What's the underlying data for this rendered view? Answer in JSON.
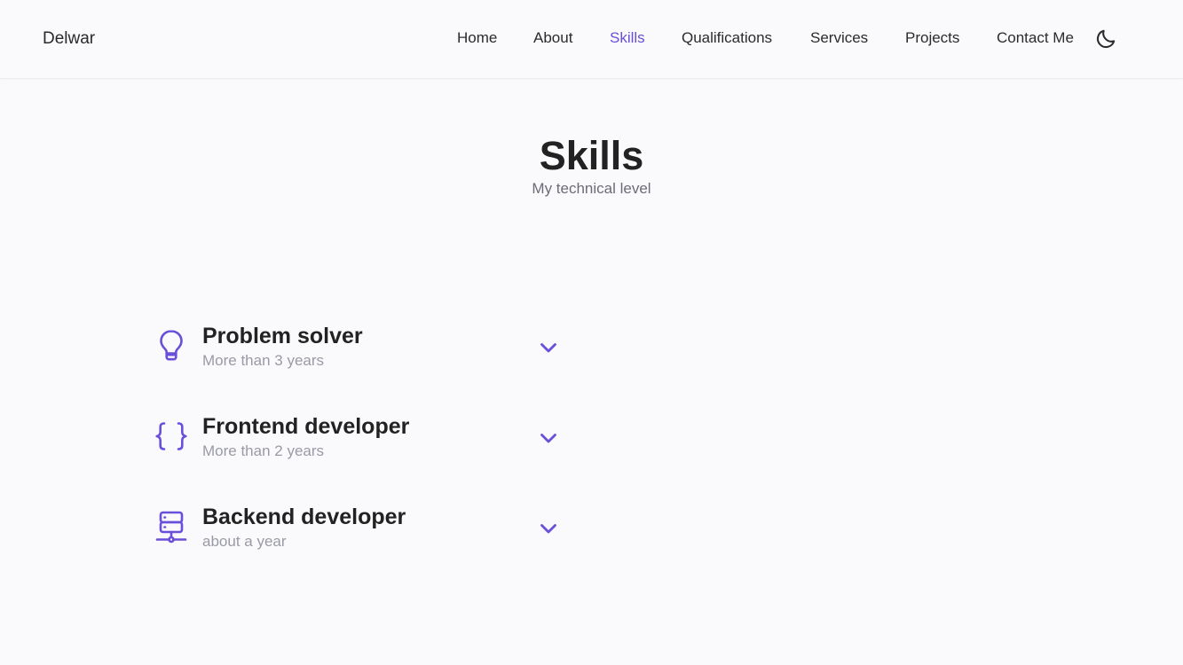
{
  "header": {
    "logo": "Delwar",
    "nav": [
      {
        "label": "Home",
        "active": false
      },
      {
        "label": "About",
        "active": false
      },
      {
        "label": "Skills",
        "active": true
      },
      {
        "label": "Qualifications",
        "active": false
      },
      {
        "label": "Services",
        "active": false
      },
      {
        "label": "Projects",
        "active": false
      },
      {
        "label": "Contact Me",
        "active": false
      }
    ],
    "theme_toggle_icon": "moon-icon"
  },
  "section": {
    "title": "Skills",
    "subtitle": "My technical level"
  },
  "skills": [
    {
      "title": "Problem solver",
      "subtitle": "More than 3 years",
      "icon": "lightbulb-icon",
      "expanded": false
    },
    {
      "title": "Frontend developer",
      "subtitle": "More than 2 years",
      "icon": "code-braces-icon",
      "expanded": false
    },
    {
      "title": "Backend developer",
      "subtitle": "about a year",
      "icon": "server-icon",
      "expanded": false
    }
  ],
  "colors": {
    "accent": "#6a4fd8",
    "background": "#fafafc",
    "text": "#222222",
    "muted": "#9a9aa6"
  }
}
